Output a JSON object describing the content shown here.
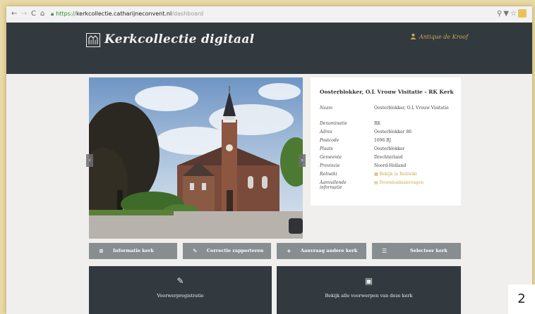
{
  "browser": {
    "url_scheme": "https://",
    "url_host": "kerkcollectie.catharijneconvent.nl",
    "url_path": "/dashboard"
  },
  "header": {
    "site_title": "Kerkcollectie digitaal",
    "user_name": "Antique de Kroof"
  },
  "church": {
    "title": "Oosterblokker, O.L Vrouw Visitatie - RK Kerk",
    "fields": [
      {
        "label": "Naam",
        "value": "Oosterblokker, O.L Vrouw Visitatie"
      },
      {
        "label": "Denominatie",
        "value": "RK"
      },
      {
        "label": "Adres",
        "value": "Oosterblokker 86"
      },
      {
        "label": "Postcode",
        "value": "1696 BJ"
      },
      {
        "label": "Plaats",
        "value": "Oosterblokker"
      },
      {
        "label": "Gemeente",
        "value": "Drechterland"
      },
      {
        "label": "Provincie",
        "value": "Noord-Holland"
      },
      {
        "label": "Reliwiki",
        "value": "Bekijk in Reliwiki"
      },
      {
        "label": "Aanvullende informatie",
        "value": "Downloadaanvragen"
      }
    ]
  },
  "actions": {
    "info": "Informatie kerk",
    "correction": "Correctie rapporteren",
    "other": "Aanvraag andere kerk",
    "select": "Selecteer kerk"
  },
  "tiles": {
    "register": "Voorwerpregistratie",
    "view_all": "Bekijk alle voorwerpen van deze kerk"
  },
  "page_number": "2",
  "colors": {
    "header_bg": "#333a3f",
    "accent": "#c9a84c",
    "button_bg": "#888d90",
    "page_bg": "#f0efee"
  }
}
